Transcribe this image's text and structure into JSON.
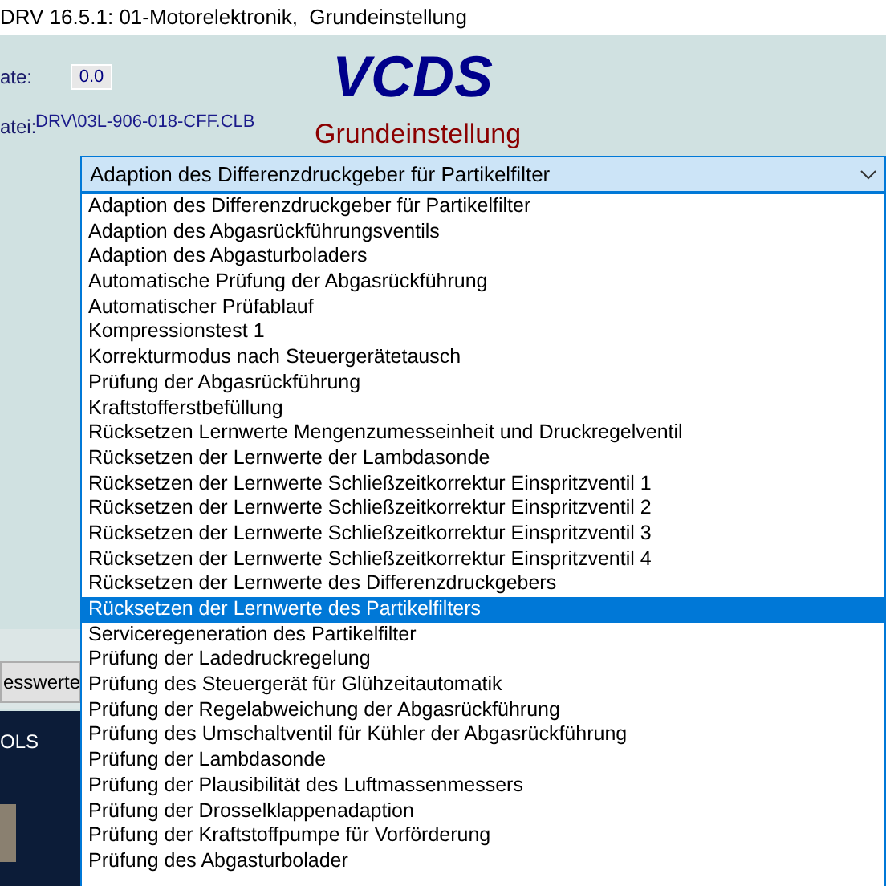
{
  "window": {
    "title": "DRV 16.5.1: 01-Motorelektronik,  Grundeinstellung"
  },
  "header": {
    "rate_label": "ate:",
    "rate_value": "0.0",
    "file_label": "atei:",
    "file_value": "DRV\\03L-906-018-CFF.CLB",
    "logo": "VCDS",
    "subtitle": "Grundeinstellung"
  },
  "combo": {
    "value": "Adaption des Differenzdruckgeber für Partikelfilter",
    "expanded": true
  },
  "list": [
    {
      "label": "Adaption des Differenzdruckgeber für Partikelfilter",
      "selected": false
    },
    {
      "label": "Adaption des Abgasrückführungsventils",
      "selected": false
    },
    {
      "label": "Adaption des Abgasturboladers",
      "selected": false
    },
    {
      "label": "Automatische Prüfung der Abgasrückführung",
      "selected": false
    },
    {
      "label": "Automatischer Prüfablauf",
      "selected": false
    },
    {
      "label": "Kompressionstest 1",
      "selected": false
    },
    {
      "label": "Korrekturmodus nach Steuergerätetausch",
      "selected": false
    },
    {
      "label": "Prüfung der Abgasrückführung",
      "selected": false
    },
    {
      "label": "Kraftstofferstbefüllung",
      "selected": false
    },
    {
      "label": "Rücksetzen Lernwerte Mengenzumesseinheit und Druckregelventil",
      "selected": false
    },
    {
      "label": "Rücksetzen der Lernwerte der Lambdasonde",
      "selected": false
    },
    {
      "label": "Rücksetzen der Lernwerte Schließzeitkorrektur Einspritzventil 1",
      "selected": false
    },
    {
      "label": "Rücksetzen der Lernwerte Schließzeitkorrektur Einspritzventil 2",
      "selected": false
    },
    {
      "label": "Rücksetzen der Lernwerte Schließzeitkorrektur Einspritzventil 3",
      "selected": false
    },
    {
      "label": "Rücksetzen der Lernwerte Schließzeitkorrektur Einspritzventil 4",
      "selected": false
    },
    {
      "label": "Rücksetzen der Lernwerte des Differenzdruckgebers",
      "selected": false
    },
    {
      "label": "Rücksetzen der Lernwerte des Partikelfilters",
      "selected": true
    },
    {
      "label": "Serviceregeneration des Partikelfilter",
      "selected": false
    },
    {
      "label": "Prüfung der Ladedruckregelung",
      "selected": false
    },
    {
      "label": "Prüfung des Steuergerät für Glühzeitautomatik",
      "selected": false
    },
    {
      "label": "Prüfung der Regelabweichung der Abgasrückführung",
      "selected": false
    },
    {
      "label": "Prüfung des Umschaltventil für Kühler der Abgasrückführung",
      "selected": false
    },
    {
      "label": "Prüfung der Lambdasonde",
      "selected": false
    },
    {
      "label": "Prüfung der Plausibilität des Luftmassenmessers",
      "selected": false
    },
    {
      "label": "Prüfung der Drosselklappenadaption",
      "selected": false
    },
    {
      "label": "Prüfung der Kraftstoffpumpe für Vorförderung",
      "selected": false
    },
    {
      "label": "Prüfung des Abgasturbolader",
      "selected": false
    }
  ],
  "left_button": "esswerte",
  "desktop": {
    "label": "OLS"
  }
}
